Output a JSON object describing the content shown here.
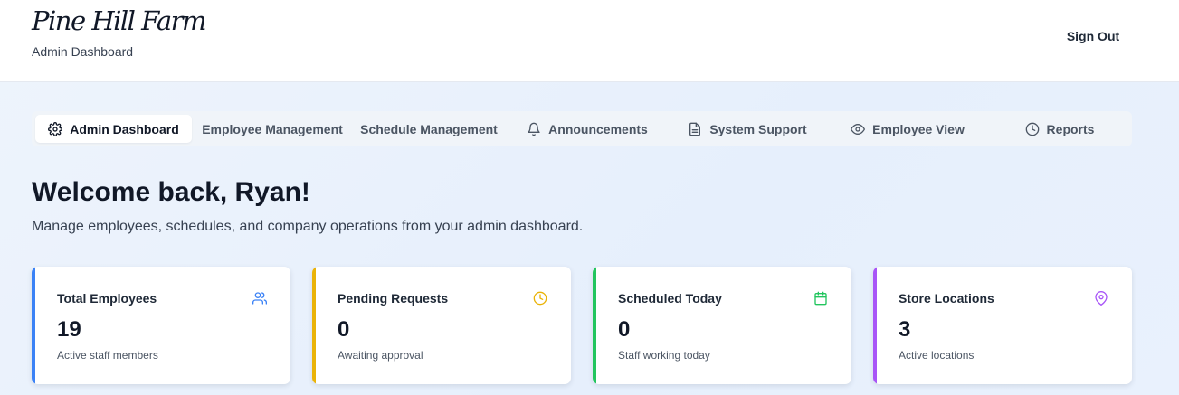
{
  "header": {
    "logo_text": "Pine Hill Farm",
    "subtitle": "Admin Dashboard",
    "sign_out_label": "Sign Out"
  },
  "nav": {
    "tabs": [
      {
        "label": "Admin Dashboard",
        "icon": "gear-icon",
        "active": true
      },
      {
        "label": "Employee Management",
        "icon": null,
        "active": false
      },
      {
        "label": "Schedule Management",
        "icon": null,
        "active": false
      },
      {
        "label": "Announcements",
        "icon": "bell-icon",
        "active": false
      },
      {
        "label": "System Support",
        "icon": "document-icon",
        "active": false
      },
      {
        "label": "Employee View",
        "icon": "eye-icon",
        "active": false
      },
      {
        "label": "Reports",
        "icon": "clock-icon",
        "active": false
      }
    ]
  },
  "main": {
    "welcome": "Welcome back, Ryan!",
    "lead": "Manage employees, schedules, and company operations from your admin dashboard."
  },
  "cards": [
    {
      "title": "Total Employees",
      "value": "19",
      "description": "Active staff members",
      "icon": "users-icon",
      "color": "#3b82f6"
    },
    {
      "title": "Pending Requests",
      "value": "0",
      "description": "Awaiting approval",
      "icon": "clock-icon",
      "color": "#eab308"
    },
    {
      "title": "Scheduled Today",
      "value": "0",
      "description": "Staff working today",
      "icon": "calendar-icon",
      "color": "#22c55e"
    },
    {
      "title": "Store Locations",
      "value": "3",
      "description": "Active locations",
      "icon": "map-pin-icon",
      "color": "#a855f7"
    }
  ]
}
